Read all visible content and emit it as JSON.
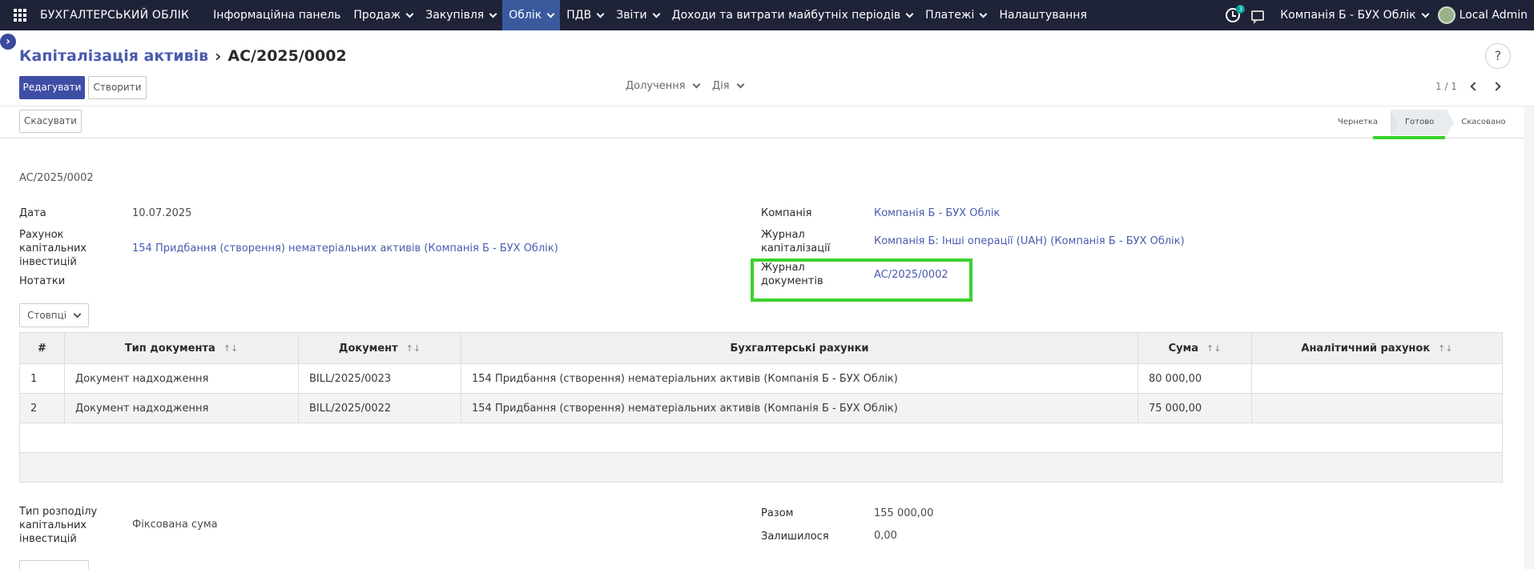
{
  "nav": {
    "brand": "БУХГАЛТЕРСЬКИЙ ОБЛІК",
    "menu": [
      {
        "label": "Інформаційна панель",
        "dropdown": false,
        "active": false
      },
      {
        "label": "Продаж",
        "dropdown": true,
        "active": false
      },
      {
        "label": "Закупівля",
        "dropdown": true,
        "active": false
      },
      {
        "label": "Облік",
        "dropdown": true,
        "active": true
      },
      {
        "label": "ПДВ",
        "dropdown": true,
        "active": false
      },
      {
        "label": "Звіти",
        "dropdown": true,
        "active": false
      },
      {
        "label": "Доходи та витрати майбутніх періодів",
        "dropdown": true,
        "active": false
      },
      {
        "label": "Платежі",
        "dropdown": true,
        "active": false
      },
      {
        "label": "Налаштування",
        "dropdown": false,
        "active": false
      }
    ],
    "activity_badge": "3",
    "company": "Компанія Б - БУХ Облік",
    "user": "Local Admin"
  },
  "header": {
    "breadcrumb_parent": "Капіталізація активів",
    "breadcrumb_current": "AC/2025/0002",
    "help": "?",
    "edit_button": "Редагувати",
    "create_button": "Створити",
    "attach_label": "Долучення",
    "action_label": "Дія",
    "pager": "1 / 1"
  },
  "statusbar": {
    "cancel_button": "Скасувати",
    "stages": [
      "Чернетка",
      "Готово",
      "Скасовано"
    ],
    "current_stage": "Готово"
  },
  "form": {
    "doc_name": "AC/2025/0002",
    "date_label": "Дата",
    "date_value": "10.07.2025",
    "account_label": "Рахунок капітальних інвестицій",
    "account_value": "154 Придбання (створення) нематеріальних активів (Компанія Б - БУХ Облік)",
    "notes_label": "Нотатки",
    "company_label": "Компанія",
    "company_value": "Компанія Б - БУХ Облік",
    "journal_label": "Журнал капіталізації",
    "journal_value": "Компанія Б: Інші операції (UAH) (Компанія Б - БУХ Облік)",
    "docjournal_label": "Журнал документів",
    "docjournal_value": "AC/2025/0002",
    "distribution_label": "Тип розподілу капітальних інвестицій",
    "distribution_value": "Фіксована сума",
    "total_label": "Разом",
    "total_value": "155 000,00",
    "remaining_label": "Залишилося",
    "remaining_value": "0,00"
  },
  "table": {
    "columns_button": "Стовпці",
    "headers": [
      "#",
      "Тип документа",
      "Документ",
      "Бухгалтерські рахунки",
      "Сума",
      "Аналітичний рахунок"
    ],
    "rows": [
      [
        "1",
        "Документ надходження",
        "BILL/2025/0023",
        "154 Придбання (створення) нематеріальних активів (Компанія Б - БУХ Облік)",
        "80 000,00",
        ""
      ],
      [
        "2",
        "Документ надходження",
        "BILL/2025/0022",
        "154 Придбання (створення) нематеріальних активів (Компанія Б - БУХ Облік)",
        "75 000,00",
        ""
      ]
    ]
  },
  "colors": {
    "navbar": "#1f2338",
    "primary": "#3f4ea5",
    "link": "#4a5bad",
    "highlight": "#39d22c"
  }
}
